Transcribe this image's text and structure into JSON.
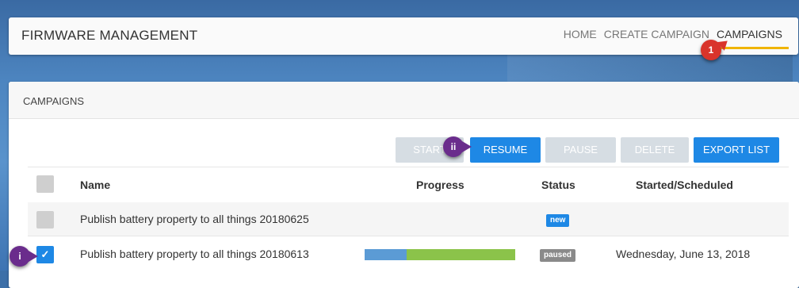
{
  "header": {
    "title": "FIRMWARE MANAGEMENT",
    "nav": {
      "home": "HOME",
      "create": "CREATE CAMPAIGN",
      "campaigns": "CAMPAIGNS"
    }
  },
  "panel": {
    "title": "CAMPAIGNS"
  },
  "actions": {
    "start": "START",
    "resume": "RESUME",
    "pause": "PAUSE",
    "delete": "DELETE",
    "export": "EXPORT LIST"
  },
  "table": {
    "headers": {
      "name": "Name",
      "progress": "Progress",
      "status": "Status",
      "started": "Started/Scheduled"
    },
    "rows": [
      {
        "name": "Publish battery property to all things 20180625",
        "status": "new",
        "started": "",
        "selected": false,
        "progress_done": null
      },
      {
        "name": "Publish battery property to all things 20180613",
        "status": "paused",
        "started": "Wednesday, June 13, 2018",
        "selected": true,
        "progress_done": 0.28,
        "progress_rest": 0.72
      }
    ]
  },
  "callouts": {
    "nav": "1",
    "resume": "ii",
    "checkbox": "i"
  },
  "colors": {
    "primary": "#1e88e5",
    "accent": "#f0b400",
    "callout_red": "#d9342b",
    "callout_purple": "#6a2c8c",
    "progress_blue": "#5b9bd5",
    "progress_green": "#8bc34a"
  }
}
